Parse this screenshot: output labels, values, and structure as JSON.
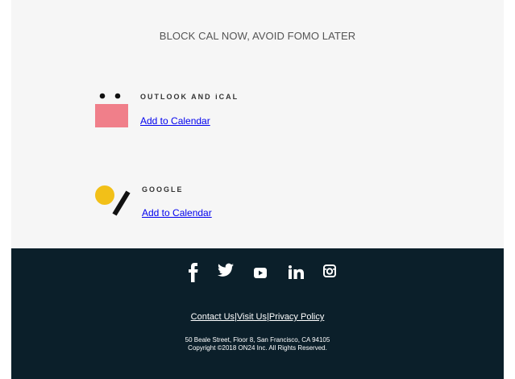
{
  "headline": "BLOCK CAL NOW, AVOID FOMO LATER",
  "calendars": {
    "outlook": {
      "label": "OUTLOOK AND iCAL",
      "link": "Add to Calendar"
    },
    "google": {
      "label": "GOOGLE",
      "link": "Add to Calendar"
    }
  },
  "colors": {
    "top_bg": "#f6f6f6",
    "footer_bg": "#0b1f2a",
    "outlook_pink": "#f07f8a",
    "google_yellow": "#f2c018",
    "link_blue": "#0000ee"
  },
  "footer": {
    "social_icons": [
      "facebook-icon",
      "twitter-icon",
      "youtube-icon",
      "linkedin-icon",
      "instagram-icon"
    ],
    "links": [
      "Contact Us",
      "Visit Us",
      "Privacy Policy"
    ],
    "separator": "|",
    "address": "50 Beale Street, Floor 8, San Francisco, CA 94105",
    "copyright": "Copyright ©2018 ON24 Inc. All Rights Reserved."
  }
}
